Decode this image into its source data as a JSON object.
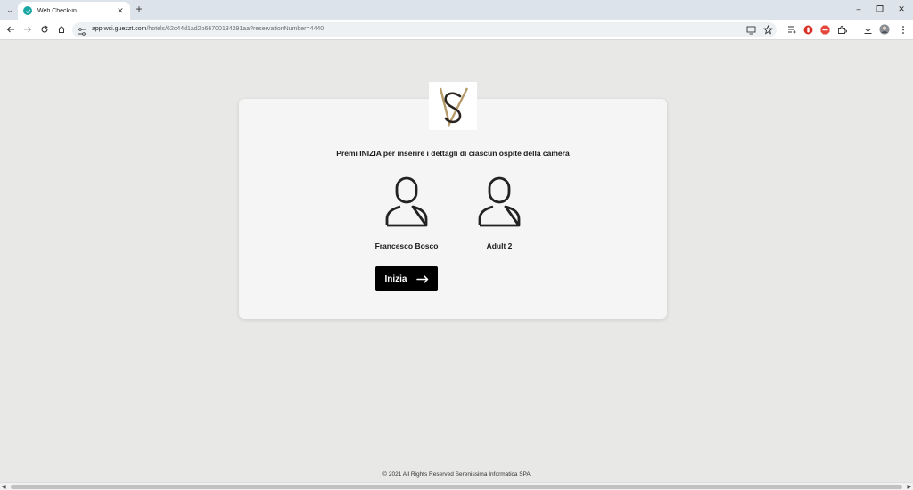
{
  "browser": {
    "tab_title": "Web Check-in",
    "tab_close": "✕",
    "new_tab": "+",
    "url_host": "app.wci.guezzt.com",
    "url_path": "/hotels/62c44d1ad2b66700134291aa?reservationNumber=4440",
    "window_controls": {
      "minimize": "–",
      "restore": "❐",
      "close": "✕"
    }
  },
  "page": {
    "logo_icon": "vs-monogram-logo",
    "instruction": "Premi INIZIA per inserire i dettagli di ciascun ospite della camera",
    "guests": [
      {
        "name": "Francesco Bosco",
        "icon": "person-icon"
      },
      {
        "name": "Adult 2",
        "icon": "person-icon"
      }
    ],
    "start_button": {
      "label": "Inizia",
      "icon": "arrow-right-icon"
    },
    "footer": "© 2021 All Rights Reserved Serenissima Informatica SPA"
  },
  "colors": {
    "background": "#e8e8e6",
    "card": "#f5f5f5",
    "button": "#000000",
    "logo_gold": "#b59a6a",
    "tab_favicon": "#1aa7a4"
  }
}
